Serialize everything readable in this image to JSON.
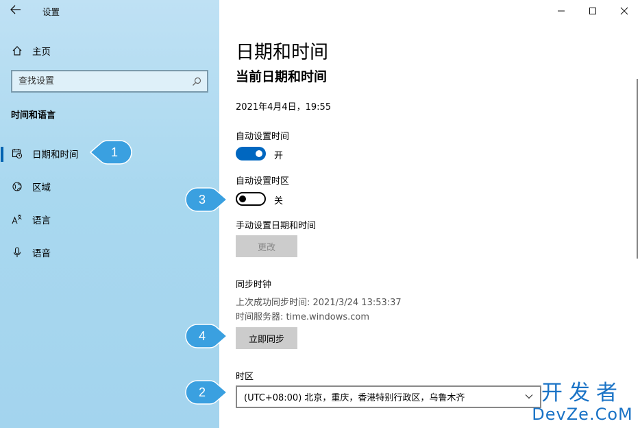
{
  "app": {
    "title": "设置"
  },
  "sidebar": {
    "home_label": "主页",
    "search_placeholder": "查找设置",
    "section_heading": "时间和语言",
    "items": [
      {
        "label": "日期和时间",
        "icon": "calendar-clock-icon",
        "selected": true
      },
      {
        "label": "区域",
        "icon": "globe-icon",
        "selected": false
      },
      {
        "label": "语言",
        "icon": "language-icon",
        "selected": false
      },
      {
        "label": "语音",
        "icon": "microphone-icon",
        "selected": false
      }
    ]
  },
  "callouts": [
    "1",
    "2",
    "3",
    "4"
  ],
  "main": {
    "page_title": "日期和时间",
    "current_heading": "当前日期和时间",
    "current_datetime": "2021年4月4日，19:55",
    "auto_time": {
      "label": "自动设置时间",
      "state": "开",
      "on": true
    },
    "auto_timezone": {
      "label": "自动设置时区",
      "state": "关",
      "on": false
    },
    "manual": {
      "label": "手动设置日期和时间",
      "button": "更改"
    },
    "sync": {
      "heading": "同步时钟",
      "last_sync": "上次成功同步时间: 2021/3/24 13:53:37",
      "server": "时间服务器: time.windows.com",
      "button": "立即同步"
    },
    "timezone": {
      "label": "时区",
      "value": "(UTC+08:00) 北京，重庆，香港特别行政区，乌鲁木齐"
    }
  },
  "watermark": {
    "top": "开发者",
    "bottom": "DevZe.CoM"
  },
  "colors": {
    "accent": "#0067c0",
    "callout": "#3aa0e0",
    "sidebar_bg": "#a9d8ef"
  }
}
